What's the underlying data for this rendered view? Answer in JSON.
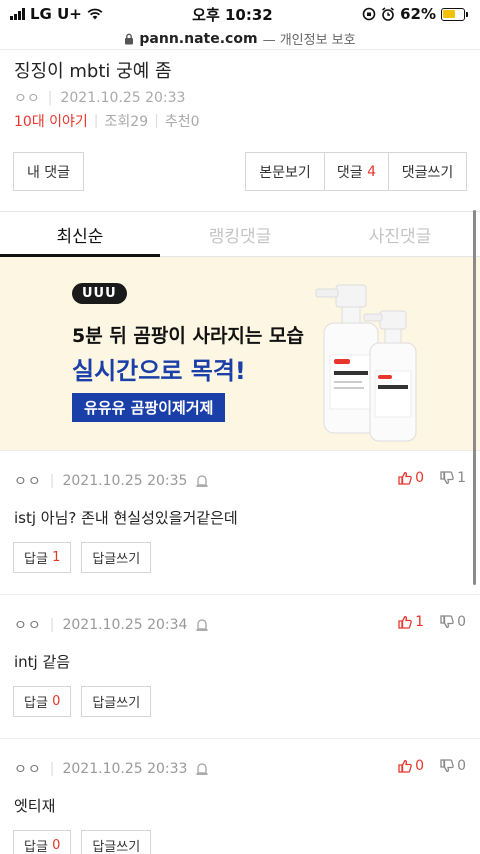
{
  "status_bar": {
    "carrier": "LG U+",
    "time": "오후 10:32",
    "battery": "62%"
  },
  "url_bar": {
    "host": "pann.nate.com",
    "note": "— 개인정보 보호"
  },
  "post": {
    "title": "징징이 mbti 궁예 좀",
    "author": "ㅇㅇ",
    "date": "2021.10.25 20:33",
    "category": "10대 이야기",
    "views_label": "조회",
    "views": "29",
    "recommend_label": "추천",
    "recommend": "0"
  },
  "toolbar": {
    "my_comments": "내 댓글",
    "body_view": "본문보기",
    "comments_label": "댓글",
    "comments_count": "4",
    "write_comment": "댓글쓰기"
  },
  "tabs": [
    {
      "label": "최신순",
      "active": true
    },
    {
      "label": "랭킹댓글",
      "active": false
    },
    {
      "label": "사진댓글",
      "active": false
    }
  ],
  "ad": {
    "badge": "UUU",
    "line1": "5분 뒤 곰팡이 사라지는 모습",
    "line2": "실시간으로 목격!",
    "cta": "유유유 곰팡이제거제",
    "bottle_label": "곰팡이 제거제"
  },
  "comments": [
    {
      "author": "ㅇㅇ",
      "date": "2021.10.25 20:35",
      "likes": "0",
      "dislikes": "1",
      "text": "istj 아님? 존내 현실성있을거같은데",
      "reply_label": "답글",
      "reply_count": "1",
      "write_reply": "답글쓰기"
    },
    {
      "author": "ㅇㅇ",
      "date": "2021.10.25 20:34",
      "likes": "1",
      "dislikes": "0",
      "text": "intj 같음",
      "reply_label": "답글",
      "reply_count": "0",
      "write_reply": "답글쓰기"
    },
    {
      "author": "ㅇㅇ",
      "date": "2021.10.25 20:33",
      "likes": "0",
      "dislikes": "0",
      "text": "엣티재",
      "reply_label": "답글",
      "reply_count": "0",
      "write_reply": "답글쓰기"
    }
  ],
  "colors": {
    "accent_red": "#e8362d",
    "ad_blue": "#1b3fa8",
    "ad_bg": "#fdf6e3"
  }
}
